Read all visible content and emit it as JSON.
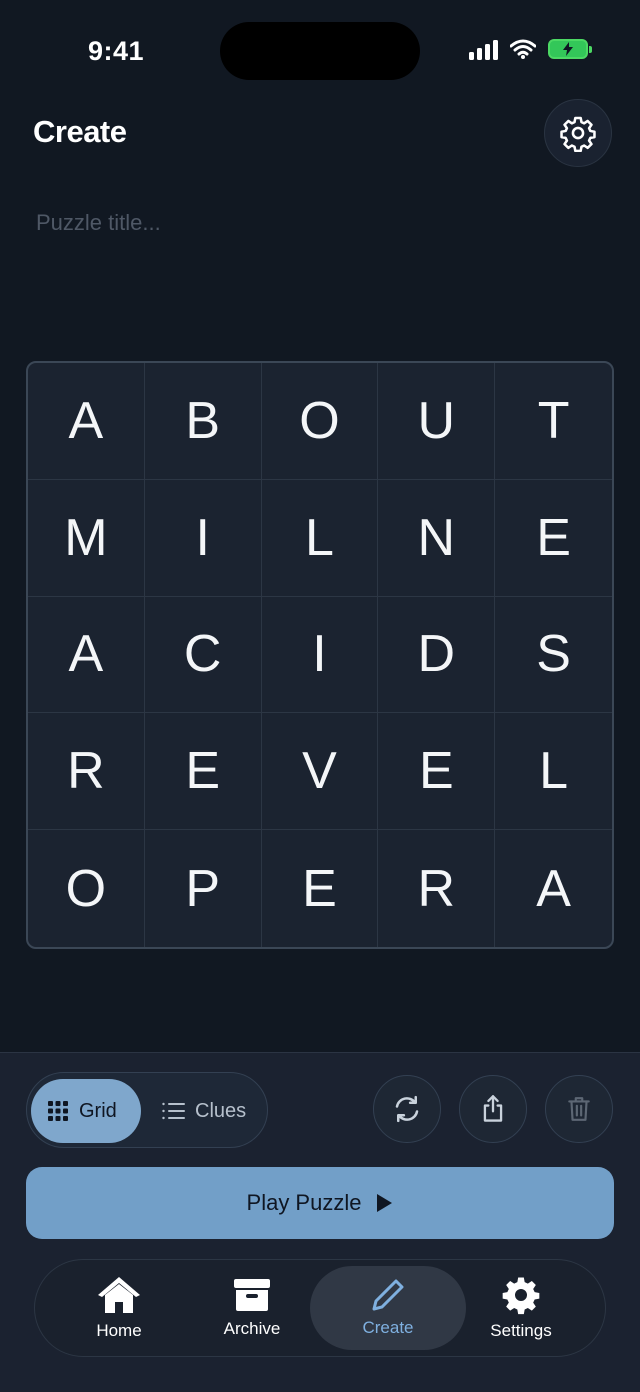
{
  "status_bar": {
    "time": "9:41"
  },
  "header": {
    "title": "Create",
    "settings_icon": "gear-icon"
  },
  "title_input": {
    "value": "",
    "placeholder": "Puzzle title..."
  },
  "grid": {
    "rows": [
      [
        "A",
        "B",
        "O",
        "U",
        "T"
      ],
      [
        "M",
        "I",
        "L",
        "N",
        "E"
      ],
      [
        "A",
        "C",
        "I",
        "D",
        "S"
      ],
      [
        "R",
        "E",
        "V",
        "E",
        "L"
      ],
      [
        "O",
        "P",
        "E",
        "R",
        "A"
      ]
    ]
  },
  "mode_toggle": {
    "grid_label": "Grid",
    "clues_label": "Clues",
    "selected": "Grid"
  },
  "actions": {
    "refresh_icon": "refresh-icon",
    "share_icon": "share-icon",
    "delete_icon": "trash-icon"
  },
  "play_button": {
    "label": "Play Puzzle"
  },
  "tabbar": {
    "tabs": [
      {
        "label": "Home",
        "icon": "house-icon"
      },
      {
        "label": "Archive",
        "icon": "archive-box-icon"
      },
      {
        "label": "Create",
        "icon": "pencil-icon"
      },
      {
        "label": "Settings",
        "icon": "gear-icon"
      }
    ],
    "active": "Create"
  },
  "colors": {
    "background": "#111822",
    "accent": "#729fc8",
    "active_tab_text": "#7fb0e0"
  }
}
